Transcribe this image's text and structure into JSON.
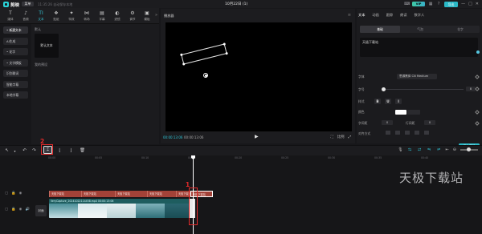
{
  "app": {
    "logo_text": "剪映",
    "menu_label": "菜单",
    "autosave_text": "11:35:26 自动保存本地",
    "doc_title": "10月22日 (1)",
    "vip_label": "VIP",
    "export_label": "导出"
  },
  "tools": [
    {
      "icon": "T",
      "label": "媒体",
      "icon_name": "media-icon"
    },
    {
      "icon": "♪",
      "label": "音频",
      "icon_name": "audio-icon"
    },
    {
      "icon": "TI",
      "label": "文本",
      "icon_name": "text-icon",
      "active": true
    },
    {
      "icon": "❖",
      "label": "贴纸",
      "icon_name": "sticker-icon"
    },
    {
      "icon": "✦",
      "label": "特效",
      "icon_name": "effects-icon"
    },
    {
      "icon": "⋈",
      "label": "转场",
      "icon_name": "transition-icon"
    },
    {
      "icon": "▤",
      "label": "字幕",
      "icon_name": "caption-icon"
    },
    {
      "icon": "◐",
      "label": "滤镜",
      "icon_name": "filter-icon"
    },
    {
      "icon": "⚙",
      "label": "调节",
      "icon_name": "adjust-icon"
    },
    {
      "icon": "▣",
      "label": "模板",
      "icon_name": "template-icon"
    }
  ],
  "leftnav": [
    {
      "label": "• 新建文本",
      "active": true
    },
    {
      "label": "AI生成"
    },
    {
      "label": "• 花字"
    },
    {
      "label": "• 文字模板"
    },
    {
      "label": "识别歌词"
    },
    {
      "label": "智能字幕"
    },
    {
      "label": "本地字幕"
    }
  ],
  "panel": {
    "default_section": "默认",
    "default_card": "默认文本",
    "mine_section": "我的预设"
  },
  "player": {
    "title": "播放器",
    "current_time": "00:00:13:06",
    "total_time": "00:00:13:06",
    "ratio_label": "比例"
  },
  "props": {
    "tabs": [
      "文本",
      "动画",
      "跟踪",
      "朗读",
      "数字人"
    ],
    "subtabs": [
      "基础",
      "气泡",
      "花字"
    ],
    "text_content": "天极下载站",
    "font_label": "字体",
    "font_value": "思源黑体 CN Medium",
    "size_label": "字号",
    "size_value": "8",
    "style_label": "样式",
    "style_buttons": [
      "B",
      "U",
      "I"
    ],
    "color_label": "颜色",
    "char_spacing_label": "字间距",
    "char_spacing_value": "0",
    "line_spacing_label": "行间距",
    "line_spacing_value": "0",
    "align_label": "对齐方式",
    "save_preset_label": "保存预设"
  },
  "timeline_toolbar": {
    "split_tooltip": "分割(Ctrl+B)",
    "annotation_1": "1",
    "annotation_2": "2"
  },
  "ruler": {
    "labels": [
      "00:00",
      "00:05",
      "00:10",
      "00:15",
      "00:20",
      "00:25",
      "00:30",
      "00:35",
      "00:40"
    ]
  },
  "tracks": {
    "cover_label": "封面",
    "text_clips": [
      "天极下载站",
      "天极下载站",
      "天极下载站",
      "天极下载站",
      "天极下载站",
      "天极下载站"
    ],
    "video_label": "VeryCapture_20241022114458.mp4  00:00:13:06"
  },
  "watermark": "天极下载站",
  "colors": {
    "accent": "#2ab8c6",
    "annotation": "#e42a2a",
    "text_clip": "#a34238",
    "video_clip": "#1e5d5f"
  }
}
